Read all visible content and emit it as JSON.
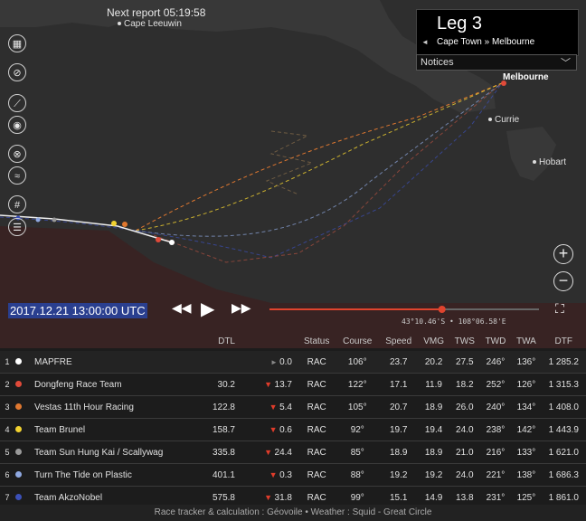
{
  "next_report": "Next report 05:19:58",
  "places": {
    "cape_leeuwin": "Cape Leeuwin",
    "melbourne": "Melbourne",
    "currie": "Currie",
    "hobart": "Hobart"
  },
  "leg": {
    "title": "Leg 3",
    "route": "Cape Town » Melbourne",
    "prev_arrow": "◄"
  },
  "notices": {
    "label": "Notices"
  },
  "time": {
    "datetime": "2017.12.21 13:00:00 UTC",
    "progress": 0.64,
    "coords": "43°10.46'S • 108°06.58'E"
  },
  "table": {
    "headers": [
      "DTL",
      "Status",
      "Course",
      "Speed",
      "VMG",
      "TWS",
      "TWD",
      "TWA",
      "DTF"
    ],
    "rows": [
      {
        "rank": "1",
        "team": "MAPFRE",
        "color": "#ffffff",
        "dtl": "",
        "trend": "flat",
        "delta": "0.0",
        "status": "RAC",
        "course": "106°",
        "speed": "23.7",
        "vmg": "20.2",
        "tws": "27.5",
        "twd": "246°",
        "twa": "136°",
        "dtf": "1 285.2"
      },
      {
        "rank": "2",
        "team": "Dongfeng Race Team",
        "color": "#e04a3a",
        "dtl": "30.2",
        "trend": "down",
        "delta": "13.7",
        "status": "RAC",
        "course": "122°",
        "speed": "17.1",
        "vmg": "11.9",
        "tws": "18.2",
        "twd": "252°",
        "twa": "126°",
        "dtf": "1 315.3"
      },
      {
        "rank": "3",
        "team": "Vestas 11th Hour Racing",
        "color": "#e07830",
        "dtl": "122.8",
        "trend": "down",
        "delta": "5.4",
        "status": "RAC",
        "course": "105°",
        "speed": "20.7",
        "vmg": "18.9",
        "tws": "26.0",
        "twd": "240°",
        "twa": "134°",
        "dtf": "1 408.0"
      },
      {
        "rank": "4",
        "team": "Team Brunel",
        "color": "#f2d230",
        "dtl": "158.7",
        "trend": "down",
        "delta": "0.6",
        "status": "RAC",
        "course": "92°",
        "speed": "19.7",
        "vmg": "19.4",
        "tws": "24.0",
        "twd": "238°",
        "twa": "142°",
        "dtf": "1 443.9"
      },
      {
        "rank": "5",
        "team": "Team Sun Hung Kai / Scallywag",
        "color": "#9a9a9a",
        "dtl": "335.8",
        "trend": "down",
        "delta": "24.4",
        "status": "RAC",
        "course": "85°",
        "speed": "18.9",
        "vmg": "18.9",
        "tws": "21.0",
        "twd": "216°",
        "twa": "133°",
        "dtf": "1 621.0"
      },
      {
        "rank": "6",
        "team": "Turn The Tide on Plastic",
        "color": "#8fa8e0",
        "dtl": "401.1",
        "trend": "down",
        "delta": "0.3",
        "status": "RAC",
        "course": "88°",
        "speed": "19.2",
        "vmg": "19.2",
        "tws": "24.0",
        "twd": "221°",
        "twa": "138°",
        "dtf": "1 686.3"
      },
      {
        "rank": "7",
        "team": "Team AkzoNobel",
        "color": "#3c50b8",
        "dtl": "575.8",
        "trend": "down",
        "delta": "31.8",
        "status": "RAC",
        "course": "99°",
        "speed": "15.1",
        "vmg": "14.9",
        "tws": "13.8",
        "twd": "231°",
        "twa": "125°",
        "dtf": "1 861.0"
      }
    ]
  },
  "footer": "Race tracker & calculation : Géovoile • Weather : Squid - Great Circle",
  "icons": [
    "map-layers-icon",
    "link-icon",
    "route-icon",
    "camera-icon",
    "compass-icon",
    "wind-icon",
    "grid-icon",
    "legend-icon",
    "zoom-in-icon",
    "zoom-out-icon",
    "rewind-icon",
    "play-icon",
    "forward-icon",
    "fullscreen-icon"
  ]
}
